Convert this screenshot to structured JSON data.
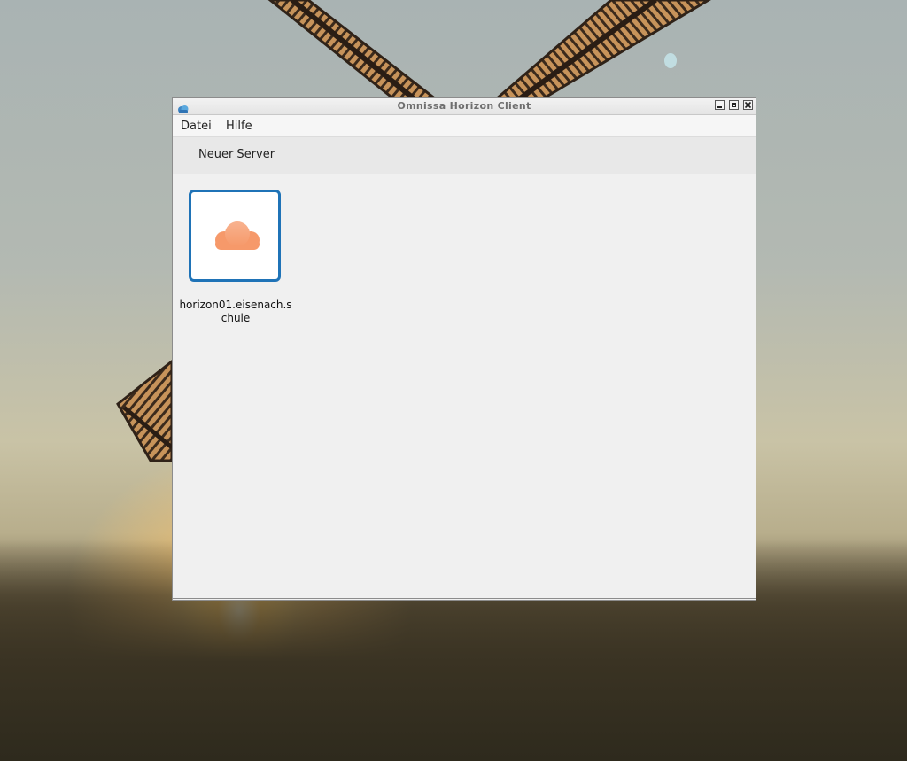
{
  "window": {
    "title": "Omnissa Horizon Client",
    "controls": [
      "minimize",
      "maximize",
      "close"
    ]
  },
  "menubar": {
    "items": [
      {
        "label": "Datei"
      },
      {
        "label": "Hilfe"
      }
    ]
  },
  "toolbar": {
    "new_server_label": "Neuer Server"
  },
  "servers": [
    {
      "label": "horizon01.eisenach.schule",
      "icon": "cloud-icon",
      "icon_color": "#f6996a",
      "selected": true,
      "selection_color": "#1f73b7"
    }
  ],
  "icons": {
    "app": "horizon-app-icon",
    "server": "cloud-icon"
  }
}
